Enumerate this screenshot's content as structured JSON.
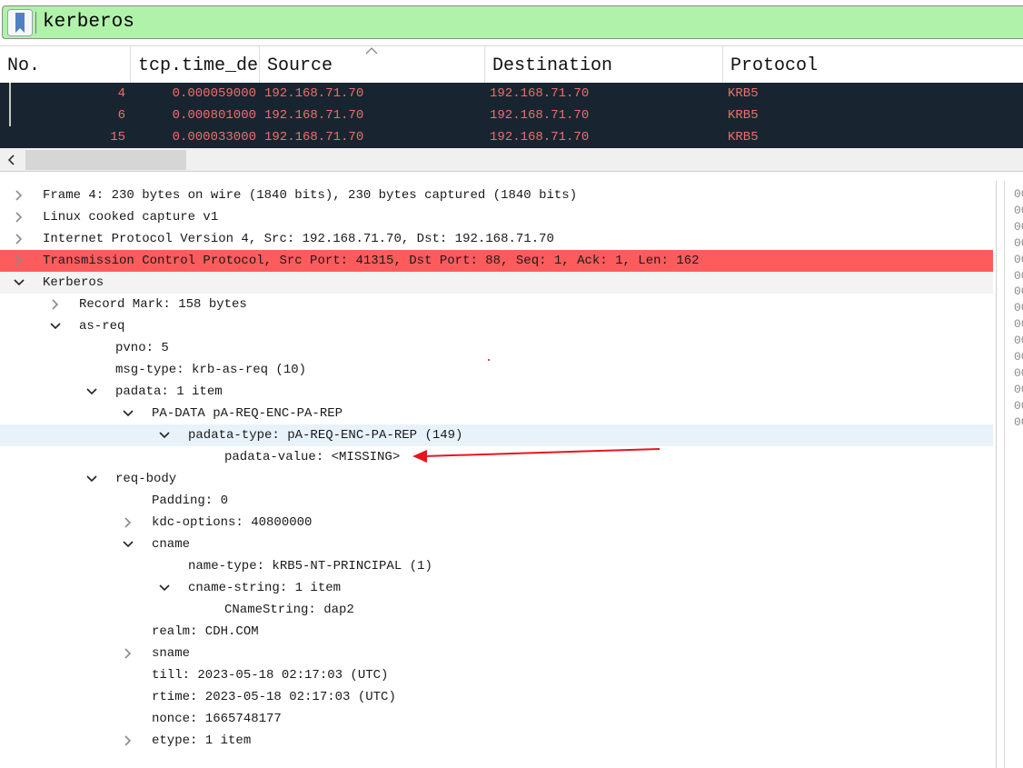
{
  "filter": {
    "value": "kerberos",
    "bg_color": "#b0f2a9"
  },
  "packet_list": {
    "columns": [
      "No.",
      "tcp.time_de",
      "Source",
      "Destination",
      "Protocol"
    ],
    "rows": [
      {
        "no": "4",
        "time": "0.000059000",
        "src": "192.168.71.70",
        "dst": "192.168.71.70",
        "proto": "KRB5"
      },
      {
        "no": "6",
        "time": "0.000801000",
        "src": "192.168.71.70",
        "dst": "192.168.71.70",
        "proto": "KRB5"
      },
      {
        "no": "15",
        "time": "0.000033000",
        "src": "192.168.71.70",
        "dst": "192.168.71.70",
        "proto": "KRB5"
      }
    ],
    "row_bg": "#182530",
    "row_fg": "#f06d6d"
  },
  "details": [
    {
      "text": "Frame 4: 230 bytes on wire (1840 bits), 230 bytes captured (1840 bits)",
      "toggle": "collapsed",
      "style": ""
    },
    {
      "text": "Linux cooked capture v1",
      "toggle": "collapsed",
      "style": ""
    },
    {
      "text": "Internet Protocol Version 4, Src: 192.168.71.70, Dst: 192.168.71.70",
      "toggle": "collapsed",
      "style": ""
    },
    {
      "text": "Transmission Control Protocol, Src Port: 41315, Dst Port: 88, Seq: 1, Ack: 1, Len: 162",
      "toggle": "collapsed",
      "style": "red"
    },
    {
      "text": "Kerberos",
      "toggle": "expanded",
      "style": "grey"
    },
    {
      "text": "Record Mark: 158 bytes",
      "toggle": "collapsed",
      "style": ""
    },
    {
      "text": "as-req",
      "toggle": "expanded",
      "style": ""
    },
    {
      "text": "pvno: 5",
      "toggle": "none",
      "style": ""
    },
    {
      "text": "msg-type: krb-as-req (10)",
      "toggle": "none",
      "style": ""
    },
    {
      "text": "padata: 1 item",
      "toggle": "expanded",
      "style": ""
    },
    {
      "text": "PA-DATA pA-REQ-ENC-PA-REP",
      "toggle": "expanded",
      "style": ""
    },
    {
      "text": "padata-type: pA-REQ-ENC-PA-REP (149)",
      "toggle": "expanded",
      "style": "sel"
    },
    {
      "text": "padata-value: <MISSING>",
      "toggle": "none",
      "style": ""
    },
    {
      "text": "req-body",
      "toggle": "expanded",
      "style": ""
    },
    {
      "text": "Padding: 0",
      "toggle": "none",
      "style": ""
    },
    {
      "text": "kdc-options: 40800000",
      "toggle": "collapsed",
      "style": ""
    },
    {
      "text": "cname",
      "toggle": "expanded",
      "style": ""
    },
    {
      "text": "name-type: kRB5-NT-PRINCIPAL (1)",
      "toggle": "none",
      "style": ""
    },
    {
      "text": "cname-string: 1 item",
      "toggle": "expanded",
      "style": ""
    },
    {
      "text": "CNameString: dap2",
      "toggle": "none",
      "style": ""
    },
    {
      "text": "realm: CDH.COM",
      "toggle": "none",
      "style": ""
    },
    {
      "text": "sname",
      "toggle": "collapsed",
      "style": ""
    },
    {
      "text": "till: 2023-05-18 02:17:03 (UTC)",
      "toggle": "none",
      "style": ""
    },
    {
      "text": "rtime: 2023-05-18 02:17:03 (UTC)",
      "toggle": "none",
      "style": ""
    },
    {
      "text": "nonce: 1665748177",
      "toggle": "none",
      "style": ""
    },
    {
      "text": "etype: 1 item",
      "toggle": "collapsed",
      "style": ""
    }
  ],
  "bytes_offsets": [
    "00",
    "00",
    "00",
    "00",
    "00",
    "00",
    "00",
    "00",
    "00",
    "00",
    "00",
    "00",
    "00",
    "00",
    "00"
  ],
  "annotation": {
    "color": "#e8141e"
  }
}
